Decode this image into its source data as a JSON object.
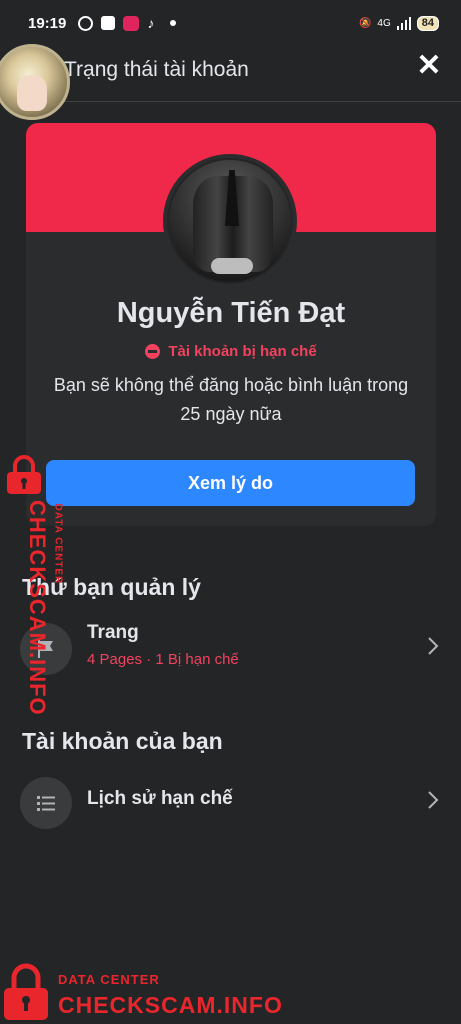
{
  "status_bar": {
    "time": "19:19",
    "network": "4G",
    "battery": "84"
  },
  "header": {
    "title": "Trạng thái tài khoản",
    "close_icon": "close-icon"
  },
  "profile": {
    "name": "Nguyễn Tiến Đạt",
    "status_label": "Tài khoản bị hạn chế",
    "description": "Bạn sẽ không thể đăng hoặc bình luận trong 25 ngày nữa",
    "action_button": "Xem lý do"
  },
  "sections": {
    "managed": {
      "title": "Thứ bạn quản lý",
      "item_title": "Trang",
      "item_subtitle": "4 Pages · 1 Bị hạn chế",
      "item_icon": "flag-icon"
    },
    "account": {
      "title": "Tài khoản của bạn",
      "item_title": "Lịch sử hạn chế",
      "item_icon": "list-icon"
    }
  },
  "watermark": {
    "subtitle": "DATA CENTER",
    "brand": "CHECKSCAM.INFO"
  },
  "colors": {
    "background": "#242526",
    "cover": "#f02849",
    "restricted": "#f3425f",
    "button": "#2d88ff",
    "watermark": "#e8262c"
  }
}
